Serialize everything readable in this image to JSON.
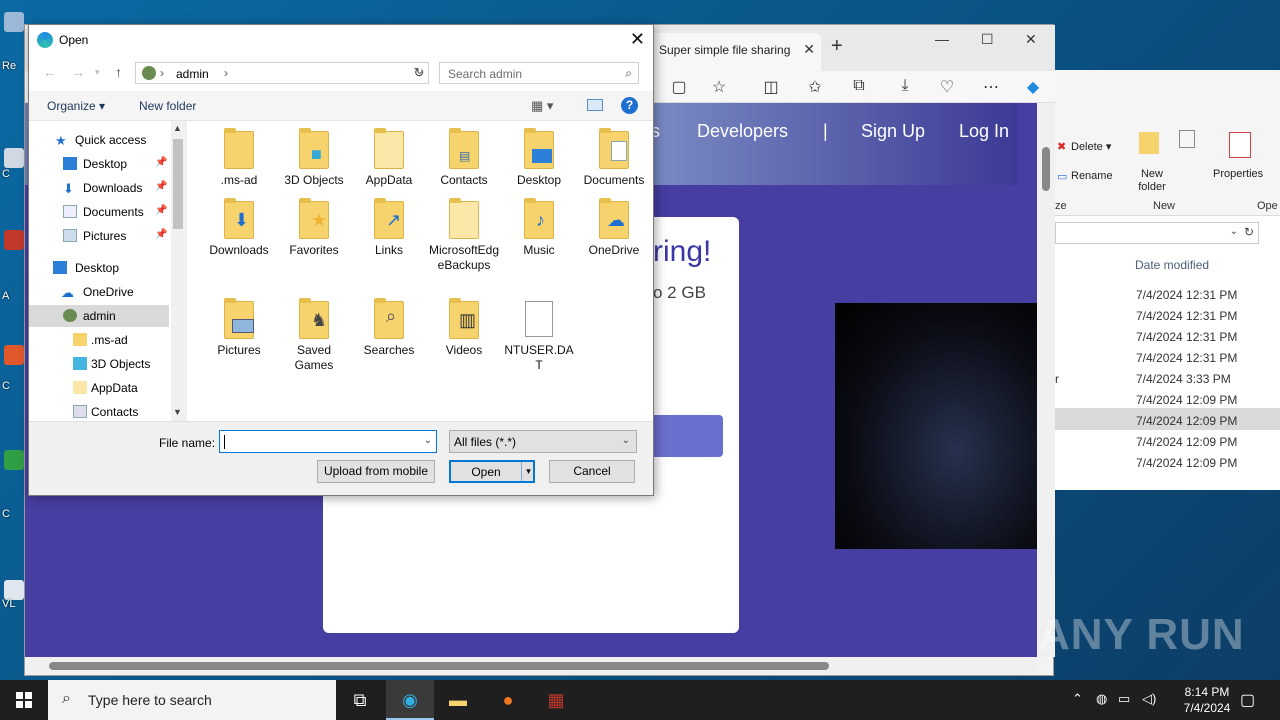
{
  "dialog": {
    "title": "Open",
    "path_user": "admin",
    "search_placeholder": "Search admin",
    "organize_label": "Organize ▾",
    "new_folder_label": "New folder",
    "nav_items": [
      {
        "label": "Quick access"
      },
      {
        "label": "Desktop"
      },
      {
        "label": "Downloads"
      },
      {
        "label": "Documents"
      },
      {
        "label": "Pictures"
      },
      {
        "label": "Desktop"
      },
      {
        "label": "OneDrive"
      },
      {
        "label": "admin"
      },
      {
        "label": ".ms-ad"
      },
      {
        "label": "3D Objects"
      },
      {
        "label": "AppData"
      },
      {
        "label": "Contacts"
      }
    ],
    "files": [
      {
        "label": ".ms-ad"
      },
      {
        "label": "3D Objects"
      },
      {
        "label": "AppData"
      },
      {
        "label": "Contacts"
      },
      {
        "label": "Desktop"
      },
      {
        "label": "Documents"
      },
      {
        "label": "Downloads"
      },
      {
        "label": "Favorites"
      },
      {
        "label": "Links"
      },
      {
        "label": "MicrosoftEdgeBackups"
      },
      {
        "label": "Music"
      },
      {
        "label": "OneDrive"
      },
      {
        "label": "Pictures"
      },
      {
        "label": "Saved Games"
      },
      {
        "label": "Searches"
      },
      {
        "label": "Videos"
      },
      {
        "label": "NTUSER.DAT"
      }
    ],
    "file_name_label": "File name:",
    "file_name_value": "",
    "filter_value": "All files (*.*)",
    "upload_label": "Upload from mobile",
    "open_label": "Open",
    "cancel_label": "Cancel"
  },
  "browser": {
    "tab_title": "Super simple file sharing",
    "nav_links": [
      "s",
      "Developers",
      "|",
      "Sign Up",
      "Log In"
    ],
    "card_heading": "ring!",
    "card_sub": "o 2 GB"
  },
  "explorer": {
    "delete_label": "Delete ▾",
    "rename_label": "Rename",
    "new_folder_label": "New folder",
    "properties_label": "Properties",
    "new_group": "New",
    "open_group": "Ope",
    "ze_group": "ze",
    "col_date": "Date modified",
    "dates": [
      "7/4/2024 12:31 PM",
      "7/4/2024 12:31 PM",
      "7/4/2024 12:31 PM",
      "7/4/2024 12:31 PM",
      "7/4/2024 3:33 PM",
      "7/4/2024 12:09 PM",
      "7/4/2024 12:09 PM",
      "7/4/2024 12:09 PM",
      "7/4/2024 12:09 PM"
    ],
    "r_fragment": "r"
  },
  "desktop": {
    "labels": [
      "Re",
      "C",
      "A",
      "C",
      "C",
      "VL"
    ]
  },
  "taskbar": {
    "search_placeholder": "Type here to search",
    "time": "8:14 PM",
    "date": "7/4/2024"
  },
  "watermark": "ANY RUN",
  "colors": {
    "accent": "#0078d7",
    "page_bg": "#463ea0",
    "folder": "#f6d36d",
    "taskbar": "#1f1f1f"
  }
}
